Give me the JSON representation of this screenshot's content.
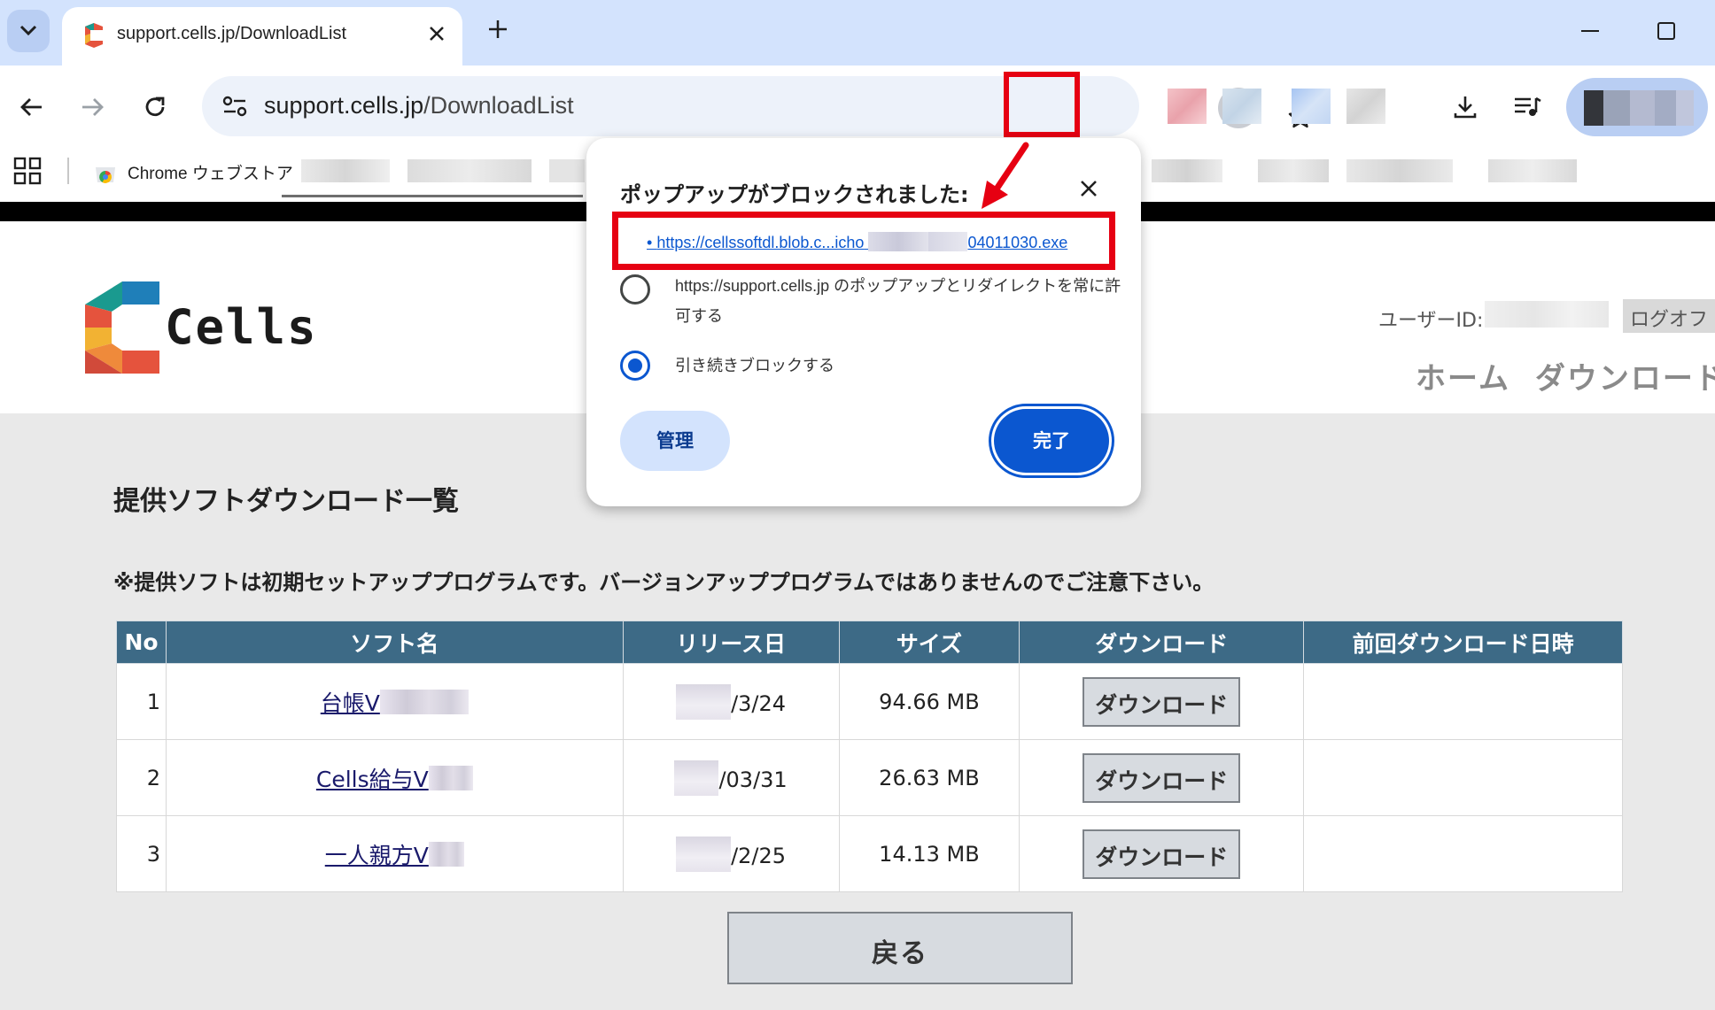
{
  "browser": {
    "tab_title": "support.cells.jp/DownloadList",
    "url_host": "support.cells.jp",
    "url_path": "/DownloadList",
    "bookmark_label": "Chrome ウェブストア",
    "accent_color": "#0b57d0"
  },
  "popup": {
    "title": "ポップアップがブロックされました:",
    "link_prefix": "https://cellssoftdl.blob.c...icho",
    "link_suffix": "04011030.exe",
    "option_allow_line1": "https://support.cells.jp のポップアップとリダイレクトを常に許",
    "option_allow_line2": "可する",
    "option_block": "引き続きブロックする",
    "selected_option": "block",
    "manage_label": "管理",
    "done_label": "完了"
  },
  "site": {
    "logo_text": "Cells",
    "userid_label": "ユーザーID:",
    "logoff_label": "ログオフ",
    "nav_home": "ホーム",
    "nav_download": "ダウンロード"
  },
  "main": {
    "title": "提供ソフトダウンロード一覧",
    "notice": "※提供ソフトは初期セットアッププログラムです。バージョンアッププログラムではありませんのでご注意下さい。",
    "columns": [
      "No",
      "ソフト名",
      "リリース日",
      "サイズ",
      "ダウンロード",
      "前回ダウンロード日時"
    ],
    "rows": [
      {
        "no": "1",
        "name": "台帳V",
        "date": "/3/24",
        "size": "94.66 MB",
        "button": "ダウンロード",
        "last": ""
      },
      {
        "no": "2",
        "name": "Cells給与V",
        "date": "/03/31",
        "size": "26.63 MB",
        "button": "ダウンロード",
        "last": ""
      },
      {
        "no": "3",
        "name": "一人親方V",
        "date": "/2/25",
        "size": "14.13 MB",
        "button": "ダウンロード",
        "last": ""
      }
    ],
    "back_label": "戻る"
  }
}
